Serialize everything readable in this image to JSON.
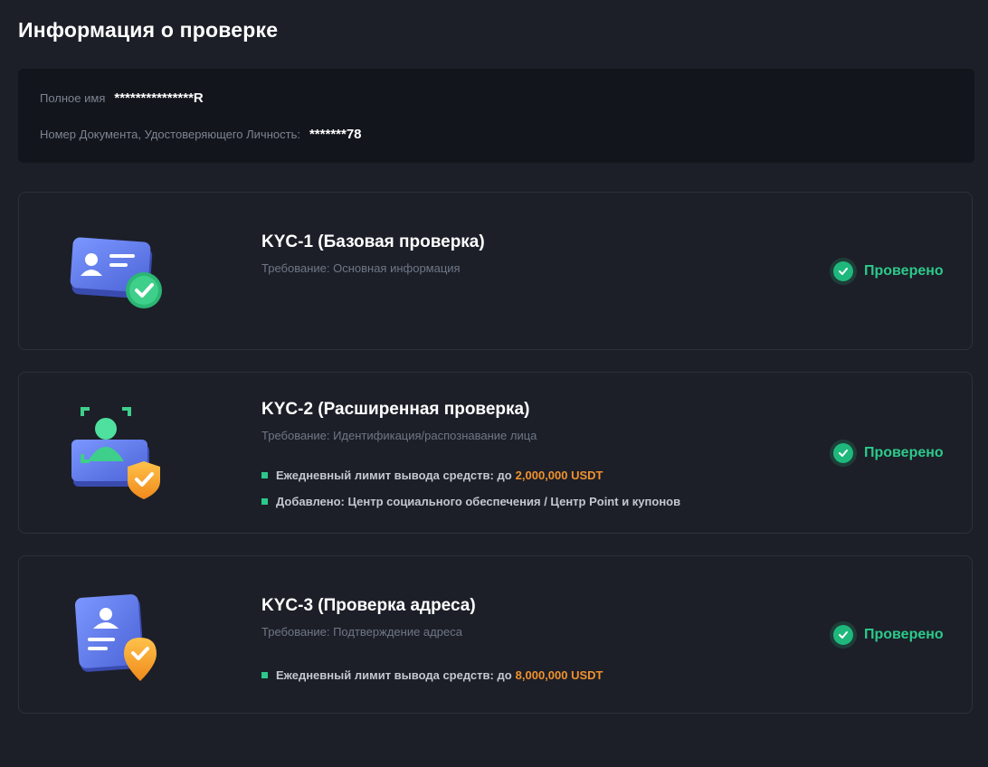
{
  "page": {
    "title": "Информация о проверке"
  },
  "identity": {
    "full_name_label": "Полное имя",
    "full_name_value": "***************R",
    "doc_label": "Номер Документа, Удостоверяющего Личность:",
    "doc_value": "*******78"
  },
  "kyc_levels": [
    {
      "title": "KYC-1  (Базовая проверка)",
      "requirement": "Требование: Основная информация",
      "status": "Проверено",
      "icon": "id-card-check-icon"
    },
    {
      "title": "KYC-2  (Расширенная проверка)",
      "requirement": "Требование: Идентификация/распознавание лица",
      "status": "Проверено",
      "icon": "face-recognition-shield-icon",
      "benefits": [
        {
          "text": "Ежедневный лимит вывода средств: до",
          "highlight": "2,000,000 USDT"
        },
        {
          "text": "Добавлено: Центр социального обеспечения / Центр Point и купонов",
          "highlight": ""
        }
      ]
    },
    {
      "title": "KYC-3  (Проверка адреса)",
      "requirement": "Требование: Подтверждение адреса",
      "status": "Проверено",
      "icon": "address-document-pin-icon",
      "benefits": [
        {
          "text": "Ежедневный лимит вывода средств: до",
          "highlight": "8,000,000 USDT"
        }
      ]
    }
  ],
  "colors": {
    "background": "#1c1f28",
    "panel": "#12151b",
    "success": "#2cc98a",
    "highlight": "#f0912d",
    "card_blue": "#5b7cf0",
    "badge_orange": "#f5a623"
  }
}
